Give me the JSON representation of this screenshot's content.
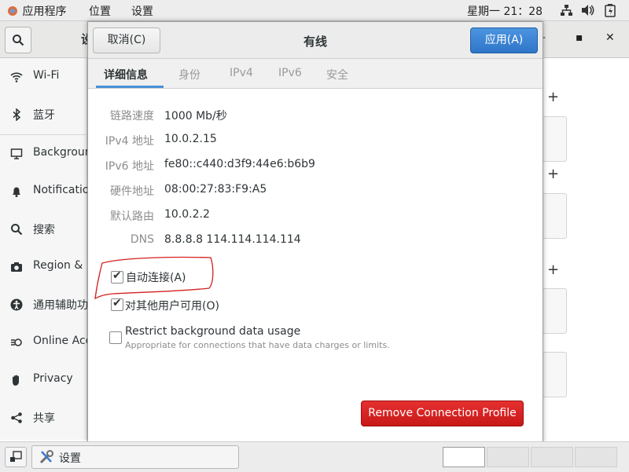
{
  "topbar": {
    "apps_label": "应用程序",
    "places_label": "位置",
    "settings_label": "设置",
    "datetime": "星期一 21：28"
  },
  "settings_window": {
    "title_partial": "设",
    "sidebar": {
      "items": [
        {
          "label": "Wi-Fi",
          "icon": "wifi-icon"
        },
        {
          "label": "蓝牙",
          "icon": "bluetooth-icon"
        },
        {
          "label": "Background",
          "icon": "monitor-icon"
        },
        {
          "label": "Notification",
          "icon": "bell-icon"
        },
        {
          "label": "搜索",
          "icon": "search-icon"
        },
        {
          "label": "Region & L",
          "icon": "camera-icon"
        },
        {
          "label": "通用辅助功",
          "icon": "accessibility-icon"
        },
        {
          "label": "Online Acc",
          "icon": "online-accounts-icon"
        },
        {
          "label": "Privacy",
          "icon": "hand-icon"
        },
        {
          "label": "共享",
          "icon": "share-icon"
        }
      ]
    }
  },
  "dialog": {
    "title": "有线",
    "cancel_label": "取消(C)",
    "apply_label": "应用(A)",
    "tabs": [
      {
        "label": "详细信息",
        "active": true
      },
      {
        "label": "身份",
        "active": false
      },
      {
        "label": "IPv4",
        "active": false
      },
      {
        "label": "IPv6",
        "active": false
      },
      {
        "label": "安全",
        "active": false
      }
    ],
    "details": [
      {
        "label": "链路速度",
        "value": "1000 Mb/秒"
      },
      {
        "label": "IPv4 地址",
        "value": "10.0.2.15"
      },
      {
        "label": "IPv6 地址",
        "value": "fe80::c440:d3f9:44e6:b6b9"
      },
      {
        "label": "硬件地址",
        "value": "08:00:27:83:F9:A5"
      },
      {
        "label": "默认路由",
        "value": "10.0.2.2"
      },
      {
        "label": "DNS",
        "value": "8.8.8.8 114.114.114.114"
      }
    ],
    "auto_connect": {
      "label": "自动连接(A)",
      "checked": true
    },
    "all_users": {
      "label": "对其他用户可用(O)",
      "checked": true
    },
    "restrict_bg": {
      "label": "Restrict background data usage",
      "sublabel": "Appropriate for connections that have data charges or limits.",
      "checked": false
    },
    "remove_label": "Remove Connection Profile"
  },
  "taskbar": {
    "window_label": "设置"
  },
  "colors": {
    "accent": "#2f76c8",
    "destructive": "#c81818",
    "annotation": "#d42020"
  }
}
